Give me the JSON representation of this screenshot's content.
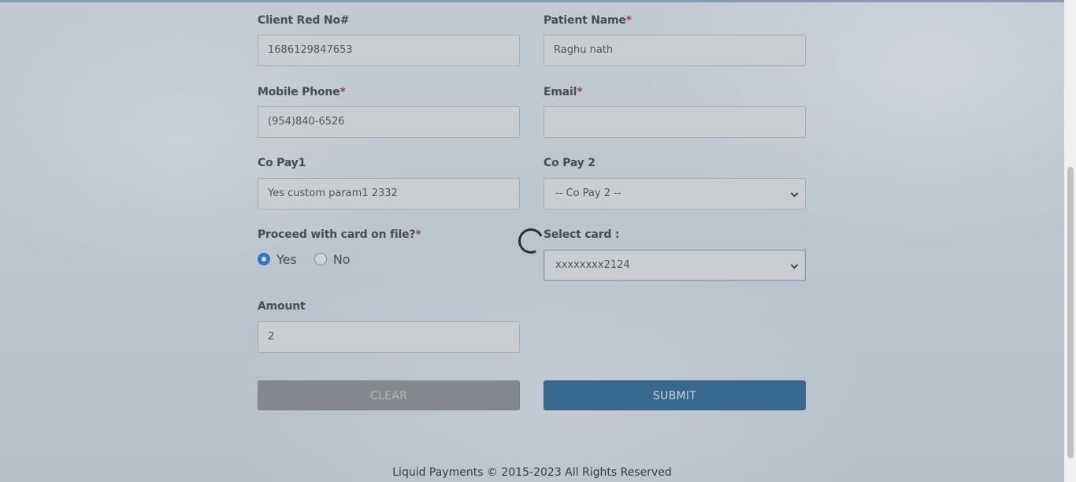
{
  "form": {
    "client_ref": {
      "label": "Client Red No#",
      "value": "1686129847653"
    },
    "patient_name": {
      "label": "Patient Name",
      "required_mark": "*",
      "value": "Raghu nath"
    },
    "mobile_phone": {
      "label": "Mobile Phone",
      "required_mark": "*",
      "value": "(954)840-6526"
    },
    "email": {
      "label": "Email",
      "required_mark": "*",
      "value": ""
    },
    "co_pay1": {
      "label": "Co Pay1",
      "value": "Yes custom param1 2332"
    },
    "co_pay2": {
      "label": "Co Pay 2",
      "selected": "-- Co Pay 2 --"
    },
    "proceed_card": {
      "label": "Proceed with card on file?",
      "required_mark": "*",
      "options": [
        "Yes",
        "No"
      ],
      "selected": "Yes"
    },
    "select_card": {
      "label": "Select card :",
      "selected": "xxxxxxxx2124"
    },
    "amount": {
      "label": "Amount",
      "value": "2"
    }
  },
  "buttons": {
    "clear_label": "CLEAR",
    "submit_label": "SUBMIT"
  },
  "footer": {
    "text": "Liquid Payments © 2015-2023 All Rights Reserved"
  },
  "colors": {
    "accent": "#1a6fd1",
    "submit_bg": "#215f92",
    "required": "#b3262e"
  },
  "icons": {
    "spinner": "loading-spinner-icon",
    "select_arrow": "chevron-down-icon"
  }
}
